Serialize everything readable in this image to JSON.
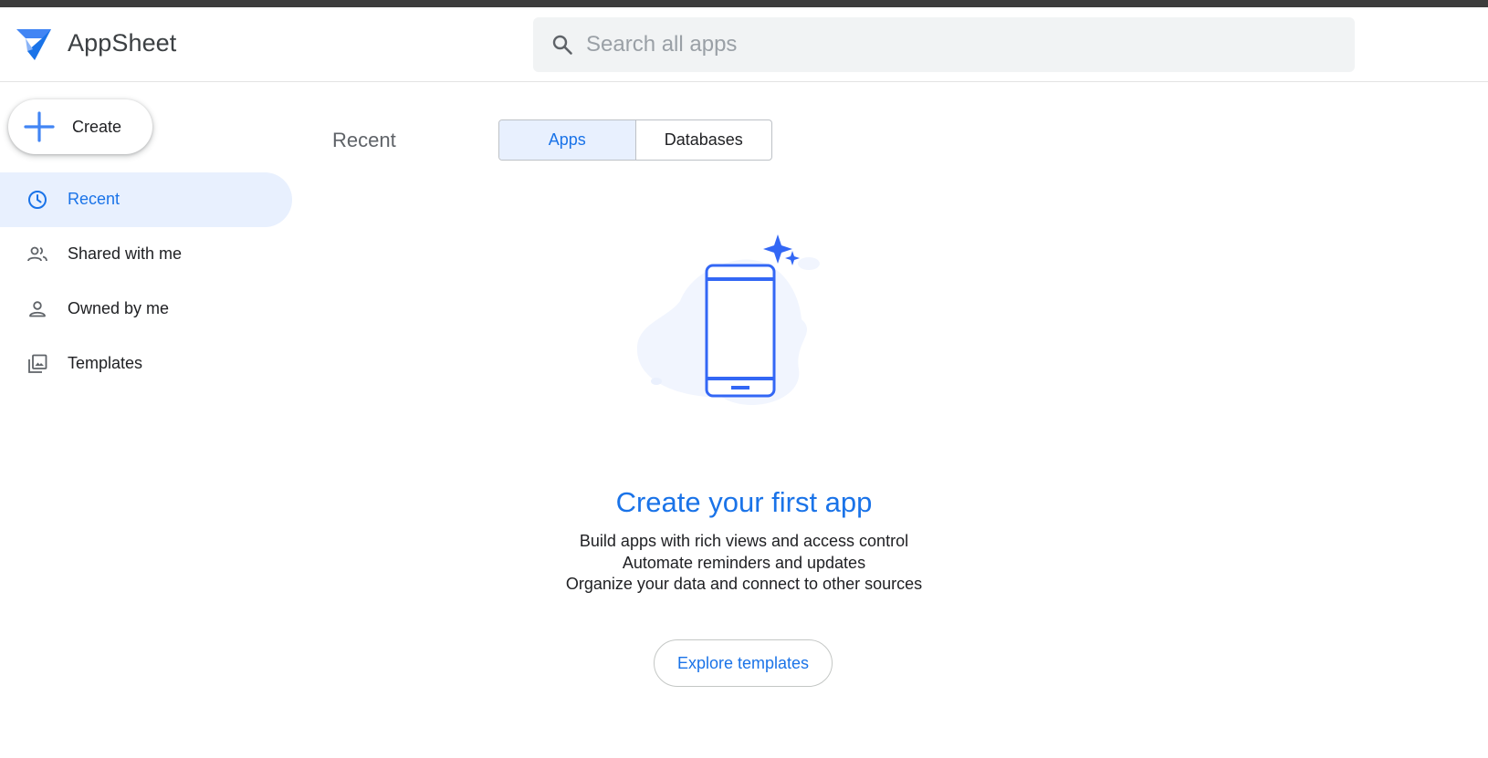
{
  "header": {
    "brand": "AppSheet",
    "search_placeholder": "Search all apps",
    "search_value": ""
  },
  "sidebar": {
    "create_label": "Create",
    "items": [
      {
        "label": "Recent",
        "icon": "clock-icon",
        "active": true
      },
      {
        "label": "Shared with me",
        "icon": "people-icon",
        "active": false
      },
      {
        "label": "Owned by me",
        "icon": "person-icon",
        "active": false
      },
      {
        "label": "Templates",
        "icon": "gallery-icon",
        "active": false
      }
    ]
  },
  "main": {
    "section_title": "Recent",
    "tabs": [
      {
        "label": "Apps",
        "selected": true
      },
      {
        "label": "Databases",
        "selected": false
      }
    ],
    "empty_state": {
      "illustration": "phone-with-sparkles",
      "title": "Create your first app",
      "lines": [
        "Build apps with rich views and access control",
        "Automate reminders and updates",
        "Organize your data and connect to other sources"
      ],
      "button_label": "Explore templates"
    }
  },
  "colors": {
    "accent": "#1a73e8",
    "active_bg": "#e8f0fe",
    "search_bg": "#f1f3f4",
    "text": "#202124",
    "muted": "#5f6368"
  }
}
